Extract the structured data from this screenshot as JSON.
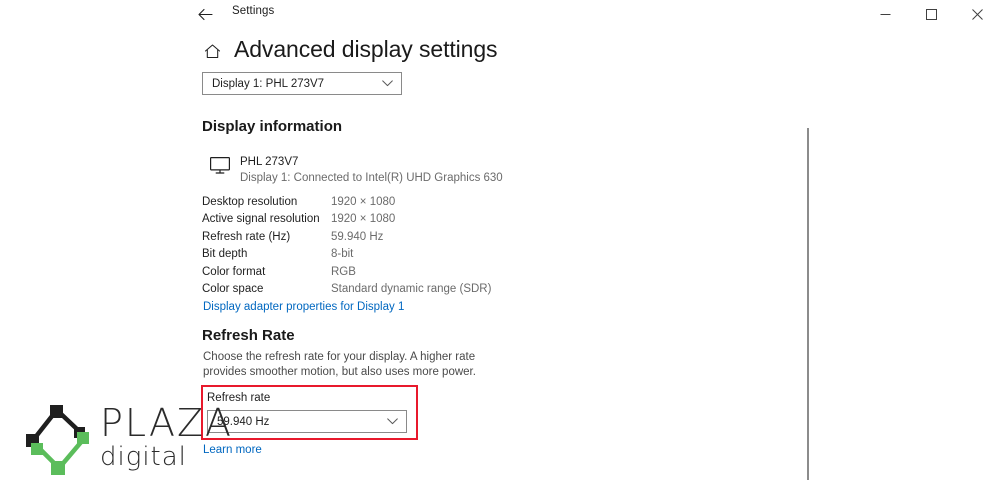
{
  "titlebar": {
    "back_icon": "back-arrow-icon",
    "app_label": "Settings",
    "minimize_label": "–",
    "maximize_label": "☐",
    "close_label": "✕"
  },
  "header": {
    "home_icon": "home-icon",
    "title": "Advanced display settings"
  },
  "display_selector": {
    "value": "Display 1: PHL 273V7",
    "chevron_icon": "chevron-down-icon"
  },
  "display_information": {
    "section_title": "Display information",
    "monitor_icon": "monitor-icon",
    "monitor_name": "PHL 273V7",
    "monitor_connection": "Display 1: Connected to Intel(R) UHD Graphics 630",
    "rows": [
      {
        "label": "Desktop resolution",
        "value": "1920 × 1080"
      },
      {
        "label": "Active signal resolution",
        "value": "1920 × 1080"
      },
      {
        "label": "Refresh rate (Hz)",
        "value": "59.940 Hz"
      },
      {
        "label": "Bit depth",
        "value": "8-bit"
      },
      {
        "label": "Color format",
        "value": "RGB"
      },
      {
        "label": "Color space",
        "value": "Standard dynamic range (SDR)"
      }
    ],
    "adapter_link": "Display adapter properties for Display 1"
  },
  "refresh_rate": {
    "section_title": "Refresh Rate",
    "description": "Choose the refresh rate for your display. A higher rate provides smoother motion, but also uses more power.",
    "field_label": "Refresh rate",
    "value": "59.940 Hz",
    "chevron_icon": "chevron-down-icon",
    "learn_more": "Learn more"
  },
  "annotation": {
    "color": "#e8192c"
  },
  "watermark": {
    "brand": "PLAZA",
    "tagline": "digital",
    "mark_dark_color": "#1f1f1f",
    "mark_green_color": "#5bbd5b"
  },
  "colors": {
    "link": "#0067c0",
    "text": "#1f1f1f",
    "muted": "#6b6b6b",
    "border": "#8a8a8a"
  }
}
